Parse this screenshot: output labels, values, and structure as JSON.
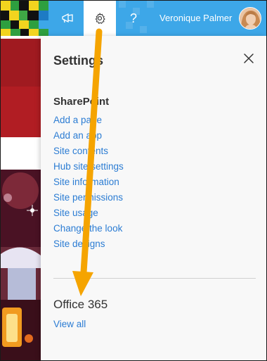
{
  "suite_bar": {
    "user_name": "Veronique Palmer",
    "help_glyph": "?",
    "icons": [
      "megaphone-icon",
      "gear-icon",
      "help-icon"
    ],
    "colors": {
      "bar": "#3da7e8",
      "gear_active_bg": "#ffffff"
    }
  },
  "settings_panel": {
    "title": "Settings",
    "sharepoint": {
      "heading": "SharePoint",
      "links": [
        "Add a page",
        "Add an app",
        "Site contents",
        "Hub site settings",
        "Site information",
        "Site permissions",
        "Site usage",
        "Change the look",
        "Site designs"
      ]
    },
    "office365": {
      "heading": "Office 365",
      "view_all": "View all"
    },
    "colors": {
      "link": "#2b7cd3",
      "panel_bg": "#f8f8f8"
    }
  },
  "annotation": {
    "arrow_color": "#f5a400"
  }
}
